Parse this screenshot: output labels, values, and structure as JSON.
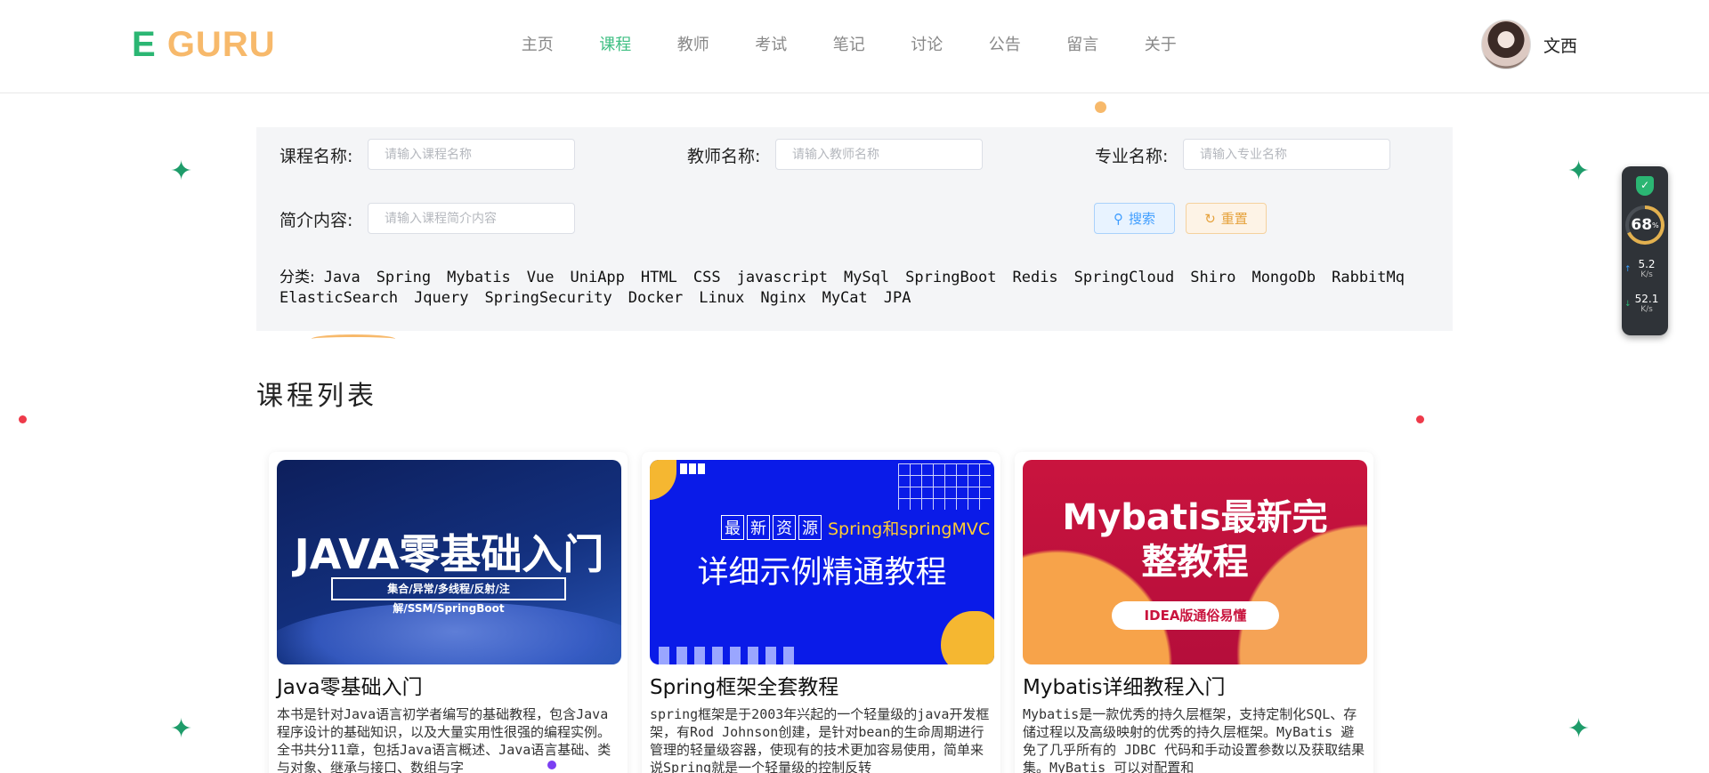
{
  "brand": {
    "e": "E",
    "guru": "GURU"
  },
  "nav": [
    "主页",
    "课程",
    "教师",
    "考试",
    "笔记",
    "讨论",
    "公告",
    "留言",
    "关于"
  ],
  "active_nav": "课程",
  "user": {
    "name": "文西"
  },
  "search": {
    "course_label": "课程名称:",
    "course_placeholder": "请输入课程名称",
    "teacher_label": "教师名称:",
    "teacher_placeholder": "请输入教师名称",
    "major_label": "专业名称:",
    "major_placeholder": "请输入专业名称",
    "intro_label": "简介内容:",
    "intro_placeholder": "请输入课程简介内容",
    "search_button": "搜索",
    "reset_button": "重置"
  },
  "categories": {
    "label": "分类:",
    "items": [
      "Java",
      "Spring",
      "Mybatis",
      "Vue",
      "UniApp",
      "HTML",
      "CSS",
      "javascript",
      "MySql",
      "SpringBoot",
      "Redis",
      "SpringCloud",
      "Shiro",
      "MongoDb",
      "RabbitMq",
      "ElasticSearch",
      "Jquery",
      "SpringSecurity",
      "Docker",
      "Linux",
      "Nginx",
      "MyCat",
      "JPA"
    ]
  },
  "section_title": "课程列表",
  "courses": [
    {
      "image_title": "JAVA零基础入门",
      "image_sub": "集合/异常/多线程/反射/注解/SSM/SpringBoot",
      "title": "Java零基础入门",
      "desc": "本书是针对Java语言初学者编写的基础教程，包含Java程序设计的基础知识，以及大量实用性很强的编程实例。全书共分11章，包括Java语言概述、Java语言基础、类与对象、继承与接口、数组与字"
    },
    {
      "image_boxes": [
        "最",
        "新",
        "资",
        "源"
      ],
      "image_tag": "Spring和springMVC",
      "image_title": "详细示例精通教程",
      "title": "Spring框架全套教程",
      "desc": "spring框架是于2003年兴起的一个轻量级的java开发框架，有Rod Johnson创建，是针对bean的生命周期进行管理的轻量级容器，使现有的技术更加容易使用，简单来说Spring就是一个轻量级的控制反转"
    },
    {
      "image_title": "Mybatis最新完整教程",
      "image_pill": "IDEA版通俗易懂",
      "title": "Mybatis详细教程入门",
      "desc": "Mybatis是一款优秀的持久层框架，支持定制化SQL、存储过程以及高级映射的优秀的持久层框架。MyBatis 避免了几乎所有的 JDBC 代码和手动设置参数以及获取结果集。MyBatis 可以对配置和"
    }
  ],
  "widget": {
    "percent": "68",
    "percent_unit": "%",
    "up_speed": "5.2",
    "up_unit": "K/s",
    "down_speed": "52.1",
    "down_unit": "K/s"
  },
  "colors": {
    "brand_green": "#2bb673",
    "brand_orange": "#f7b96b",
    "nav_active": "#3fbf83"
  }
}
